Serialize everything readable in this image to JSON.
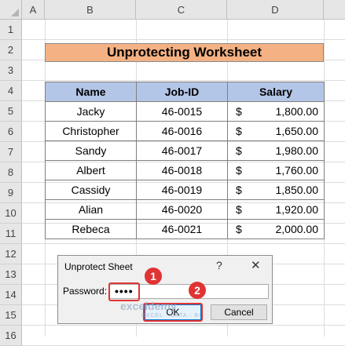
{
  "columns": [
    "A",
    "B",
    "C",
    "D"
  ],
  "rows": [
    "1",
    "2",
    "3",
    "4",
    "5",
    "6",
    "7",
    "8",
    "9",
    "10",
    "11",
    "12",
    "13",
    "14",
    "15",
    "16"
  ],
  "title": "Unprotecting Worksheet",
  "table": {
    "headers": [
      "Name",
      "Job-ID",
      "Salary"
    ],
    "currency": "$",
    "rows": [
      {
        "name": "Jacky",
        "job": "46-0015",
        "salary": "1,800.00"
      },
      {
        "name": "Christopher",
        "job": "46-0016",
        "salary": "1,650.00"
      },
      {
        "name": "Sandy",
        "job": "46-0017",
        "salary": "1,980.00"
      },
      {
        "name": "Albert",
        "job": "46-0018",
        "salary": "1,760.00"
      },
      {
        "name": "Cassidy",
        "job": "46-0019",
        "salary": "1,850.00"
      },
      {
        "name": "Alian",
        "job": "46-0020",
        "salary": "1,920.00"
      },
      {
        "name": "Rebeca",
        "job": "46-0021",
        "salary": "2,000.00"
      }
    ]
  },
  "dialog": {
    "title": "Unprotect Sheet",
    "help": "?",
    "close": "✕",
    "password_label": "Password:",
    "password_value": "••••",
    "ok": "OK",
    "cancel": "Cancel"
  },
  "badges": [
    "1",
    "2"
  ],
  "watermark": {
    "name": "exceldemy",
    "tagline": "EXCEL · DATA · BI"
  },
  "colors": {
    "title_fill": "#f4b183",
    "header_fill": "#b4c6e7",
    "highlight": "#e03333"
  }
}
